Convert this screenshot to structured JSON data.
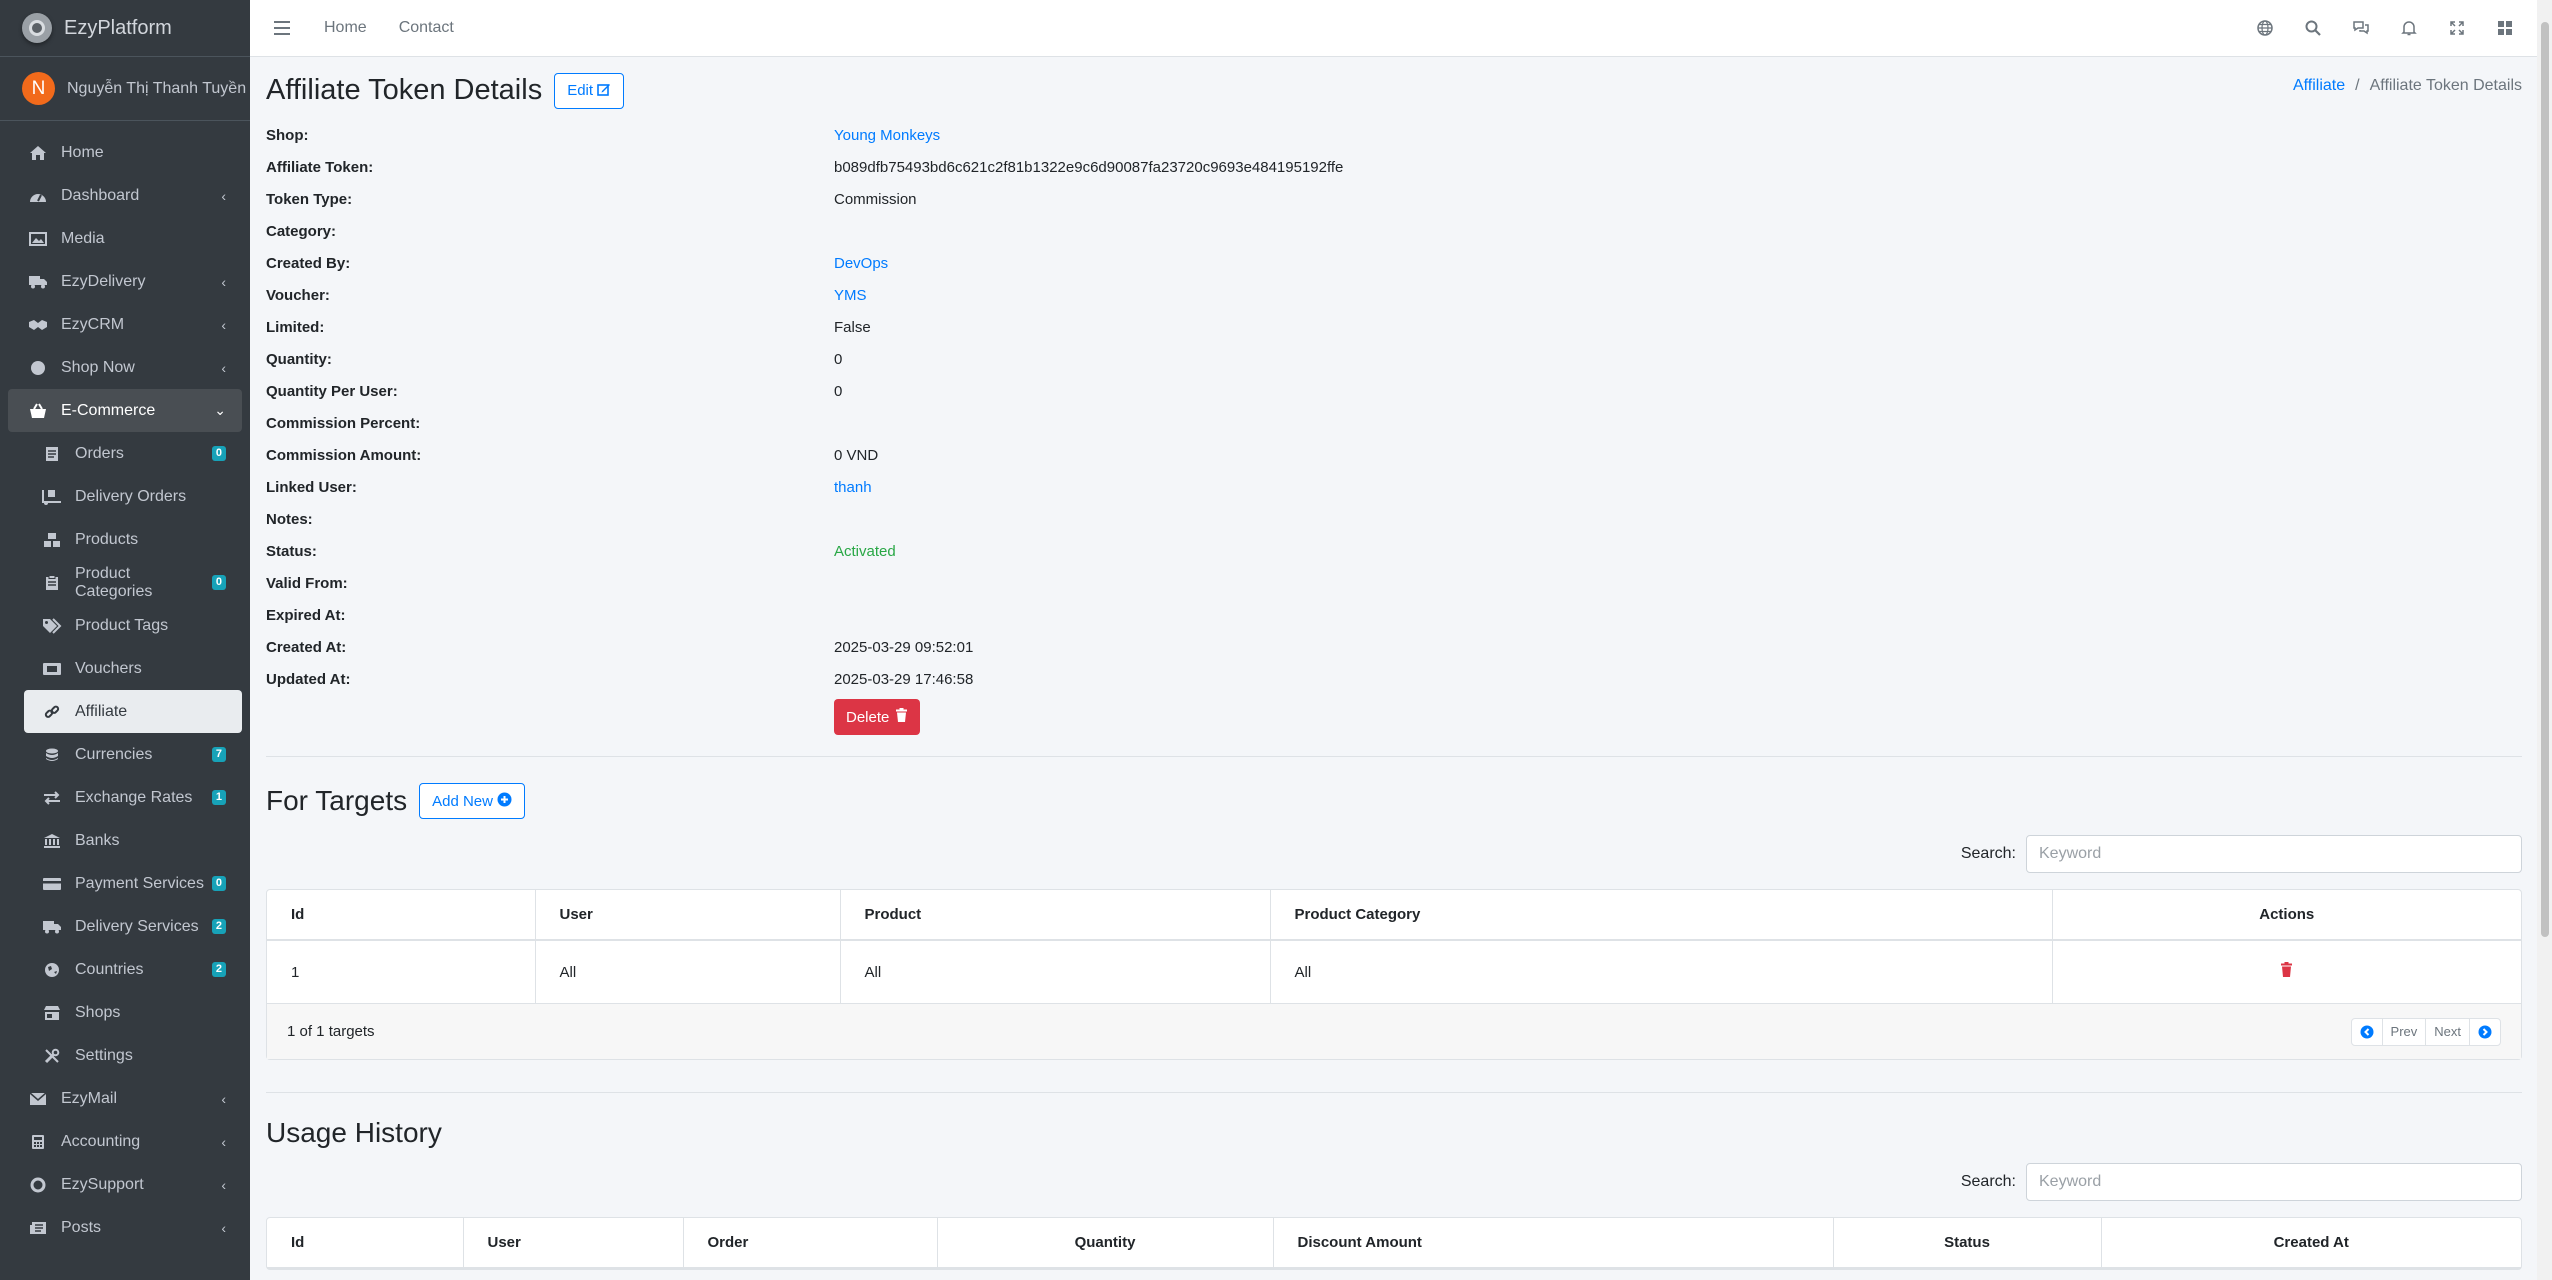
{
  "app": {
    "brand": "EzyPlatform"
  },
  "user": {
    "initial": "N",
    "name": "Nguyễn Thị Thanh Tuyền"
  },
  "sidebar": {
    "items": [
      {
        "label": "Home"
      },
      {
        "label": "Dashboard"
      },
      {
        "label": "Media"
      },
      {
        "label": "EzyDelivery"
      },
      {
        "label": "EzyCRM"
      },
      {
        "label": "Shop Now"
      },
      {
        "label": "E-Commerce"
      }
    ],
    "sub": [
      {
        "label": "Orders",
        "badge": "0"
      },
      {
        "label": "Delivery Orders"
      },
      {
        "label": "Products"
      },
      {
        "label": "Product Categories",
        "badge": "0"
      },
      {
        "label": "Product Tags"
      },
      {
        "label": "Vouchers"
      },
      {
        "label": "Affiliate"
      },
      {
        "label": "Currencies",
        "badge": "7"
      },
      {
        "label": "Exchange Rates",
        "badge": "1"
      },
      {
        "label": "Banks"
      },
      {
        "label": "Payment Services",
        "badge": "0"
      },
      {
        "label": "Delivery Services",
        "badge": "2"
      },
      {
        "label": "Countries",
        "badge": "2"
      },
      {
        "label": "Shops"
      },
      {
        "label": "Settings"
      }
    ],
    "bottom": [
      {
        "label": "EzyMail"
      },
      {
        "label": "Accounting"
      },
      {
        "label": "EzySupport"
      },
      {
        "label": "Posts"
      }
    ]
  },
  "topbar": {
    "home": "Home",
    "contact": "Contact"
  },
  "page": {
    "title": "Affiliate Token Details",
    "edit_label": "Edit",
    "breadcrumb_parent": "Affiliate",
    "breadcrumb_current": "Affiliate Token Details"
  },
  "details": {
    "shop_label": "Shop:",
    "shop": "Young Monkeys",
    "token_label": "Affiliate Token:",
    "token": "b089dfb75493bd6c621c2f81b1322e9c6d90087fa23720c9693e484195192ffe",
    "type_label": "Token Type:",
    "type": "Commission",
    "category_label": "Category:",
    "category": "",
    "created_by_label": "Created By:",
    "created_by": "DevOps",
    "voucher_label": "Voucher:",
    "voucher": "YMS",
    "limited_label": "Limited:",
    "limited": "False",
    "quantity_label": "Quantity:",
    "quantity": "0",
    "qpu_label": "Quantity Per User:",
    "qpu": "0",
    "cpct_label": "Commission Percent:",
    "cpct": "",
    "camt_label": "Commission Amount:",
    "camt": "0 VND",
    "linked_label": "Linked User:",
    "linked": "thanh",
    "notes_label": "Notes:",
    "notes": "",
    "status_label": "Status:",
    "status": "Activated",
    "valid_label": "Valid From:",
    "valid": "",
    "expired_label": "Expired At:",
    "expired": "",
    "created_label": "Created At:",
    "created": "2025-03-29 09:52:01",
    "updated_label": "Updated At:",
    "updated": "2025-03-29 17:46:58",
    "delete_label": "Delete"
  },
  "targets": {
    "title": "For Targets",
    "add_label": "Add New",
    "search_label": "Search:",
    "search_placeholder": "Keyword",
    "columns": [
      "Id",
      "User",
      "Product",
      "Product Category",
      "Actions"
    ],
    "rows": [
      {
        "id": "1",
        "user": "All",
        "product": "All",
        "category": "All"
      }
    ],
    "summary": "1 of 1 targets",
    "prev": "Prev",
    "next": "Next"
  },
  "usage": {
    "title": "Usage History",
    "search_label": "Search:",
    "search_placeholder": "Keyword",
    "columns": [
      "Id",
      "User",
      "Order",
      "Quantity",
      "Discount Amount",
      "Status",
      "Created At"
    ]
  }
}
